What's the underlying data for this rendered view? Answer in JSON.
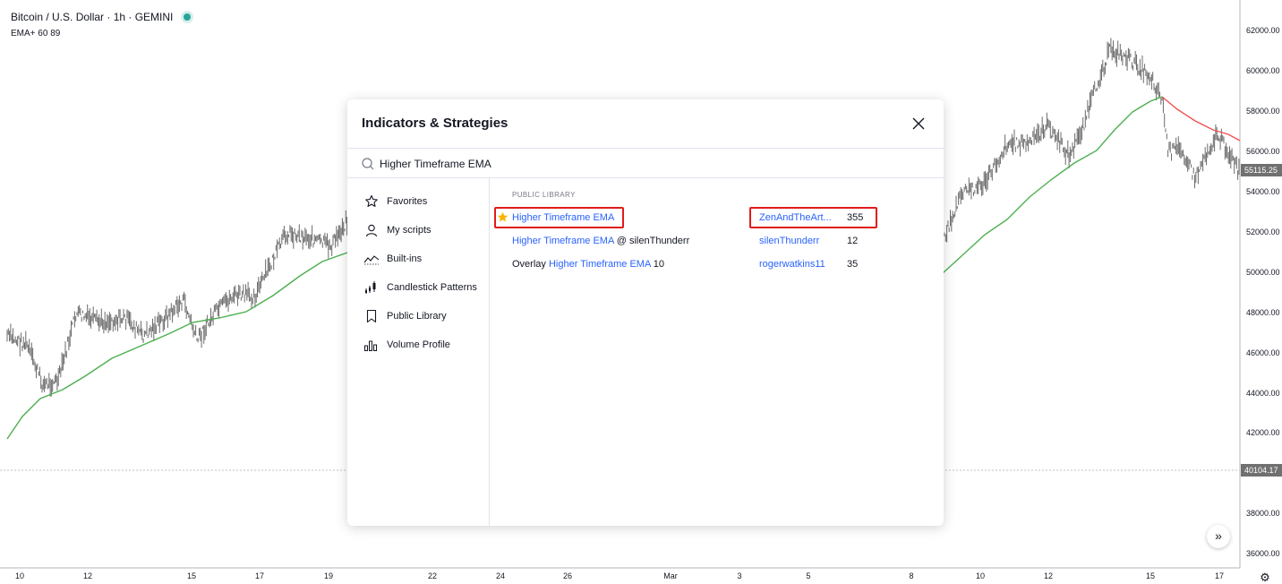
{
  "legend": {
    "symbol": "Bitcoin / U.S. Dollar · 1h · GEMINI",
    "indicator": "EMA+ 60 89",
    "status_color": "#26a69a"
  },
  "price_axis": {
    "labels": [
      "62000.00",
      "60000.00",
      "58000.00",
      "56000.00",
      "54000.00",
      "52000.00",
      "50000.00",
      "48000.00",
      "46000.00",
      "44000.00",
      "42000.00",
      "38000.00",
      "36000.00"
    ],
    "last_price": "55115.25",
    "last_price_color": "#707070",
    "low_line_price": "40104.17",
    "low_line_color": "#707070"
  },
  "time_axis": {
    "labels": [
      "10",
      "12",
      "15",
      "17",
      "19",
      "22",
      "24",
      "26",
      "Mar",
      "3",
      "5",
      "8",
      "10",
      "12",
      "15",
      "17"
    ]
  },
  "chart_colors": {
    "candles": "#6b6b6b",
    "ema_up": "#4caf50",
    "ema_down": "#ef5350"
  },
  "dialog": {
    "title": "Indicators & Strategies",
    "search": {
      "value": "Higher Timeframe EMA",
      "placeholder": "Search"
    },
    "sidebar": {
      "items": [
        {
          "label": "Favorites",
          "icon": "star-outline-icon"
        },
        {
          "label": "My scripts",
          "icon": "user-icon"
        },
        {
          "label": "Built-ins",
          "icon": "chart-line-icon"
        },
        {
          "label": "Candlestick Patterns",
          "icon": "candlestick-icon"
        },
        {
          "label": "Public Library",
          "icon": "bookmark-icon"
        },
        {
          "label": "Volume Profile",
          "icon": "volume-profile-icon"
        }
      ]
    },
    "results": {
      "section": "PUBLIC LIBRARY",
      "items": [
        {
          "prefix": "",
          "highlight": "Higher Timeframe EMA",
          "suffix": "",
          "author": "ZenAndTheArt...",
          "count": "355",
          "favorite": true
        },
        {
          "prefix": "",
          "highlight": "Higher Timeframe EMA",
          "suffix": " @ silenThunderr",
          "author": "silenThunderr",
          "count": "12",
          "favorite": false
        },
        {
          "prefix": "Overlay ",
          "highlight": "Higher Timeframe EMA",
          "suffix": " 10",
          "author": "rogerwatkins11",
          "count": "35",
          "favorite": false
        }
      ]
    }
  },
  "colors": {
    "accent": "#2962ff",
    "highlight_box": "#e01b1b",
    "favorite_star": "#f7b500"
  }
}
